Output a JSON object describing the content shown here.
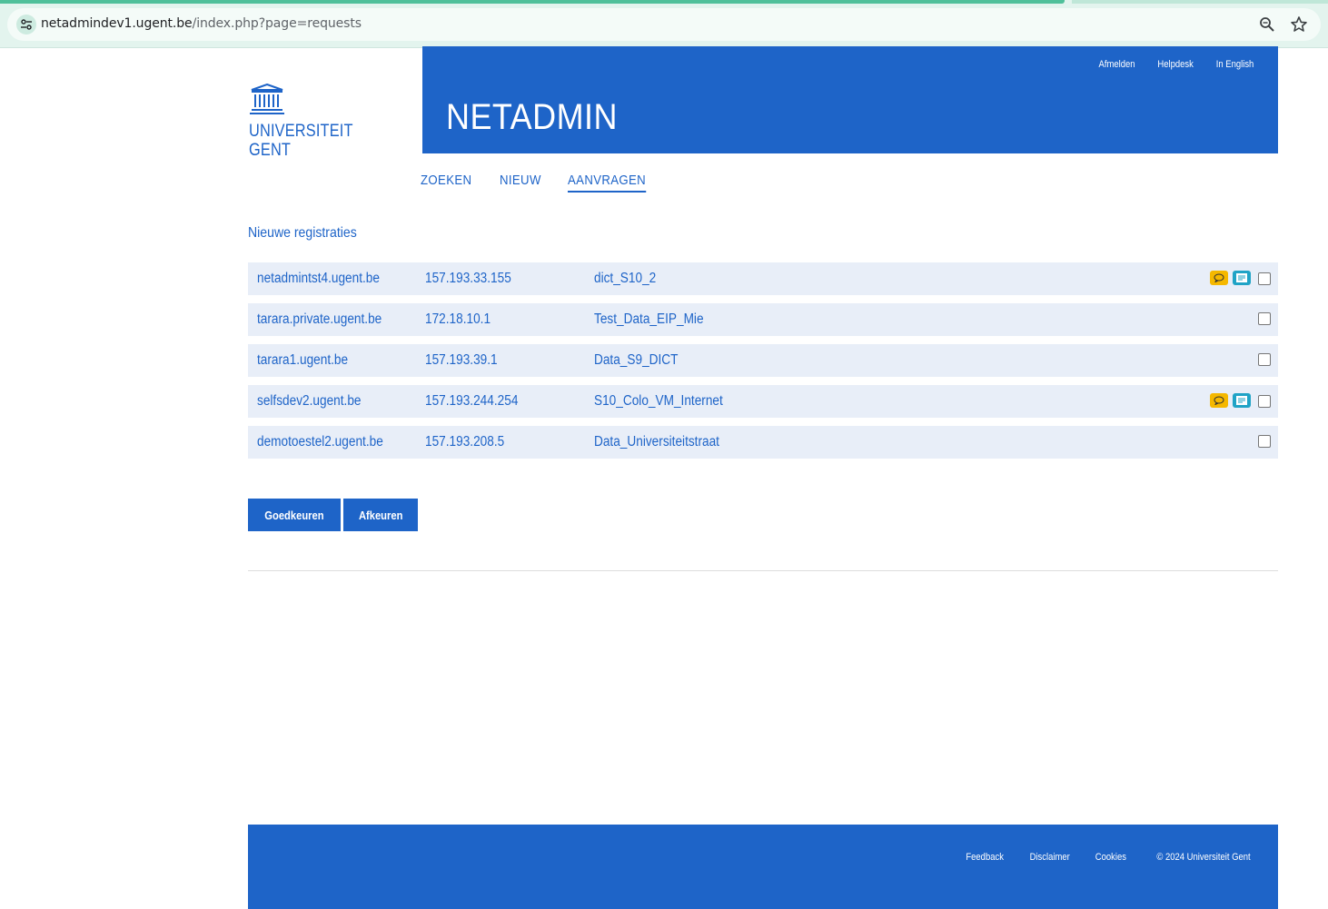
{
  "browser": {
    "url_host": "netadmindev1.ugent.be",
    "url_path": "/index.php?page=requests"
  },
  "logo": {
    "line1": "UNIVERSITEIT",
    "line2": "GENT"
  },
  "header": {
    "app_title": "NETADMIN",
    "links": {
      "logout": "Afmelden",
      "helpdesk": "Helpdesk",
      "english": "In English"
    }
  },
  "nav": {
    "search": "ZOEKEN",
    "new": "NIEUW",
    "requests": "AANVRAGEN",
    "active": "AANVRAGEN"
  },
  "section_title": "Nieuwe registraties",
  "requests": [
    {
      "host": "netadmintst4.ugent.be",
      "ip": "157.193.33.155",
      "network": "dict_S10_2",
      "has_comment": true,
      "has_info": true,
      "checked": false
    },
    {
      "host": "tarara.private.ugent.be",
      "ip": "172.18.10.1",
      "network": "Test_Data_EIP_Mie",
      "has_comment": false,
      "has_info": false,
      "checked": false
    },
    {
      "host": "tarara1.ugent.be",
      "ip": "157.193.39.1",
      "network": "Data_S9_DICT",
      "has_comment": false,
      "has_info": false,
      "checked": false
    },
    {
      "host": "selfsdev2.ugent.be",
      "ip": "157.193.244.254",
      "network": "S10_Colo_VM_Internet",
      "has_comment": true,
      "has_info": true,
      "checked": false
    },
    {
      "host": "demotoestel2.ugent.be",
      "ip": "157.193.208.5",
      "network": "Data_Universiteitstraat",
      "has_comment": false,
      "has_info": false,
      "checked": false
    }
  ],
  "actions": {
    "approve": "Goedkeuren",
    "reject": "Afkeuren"
  },
  "footer": {
    "feedback": "Feedback",
    "disclaimer": "Disclaimer",
    "cookies": "Cookies",
    "copyright": "© 2024 Universiteit Gent"
  },
  "colors": {
    "brand_blue": "#1e64c8",
    "row_bg": "#e8eef8",
    "comment_badge": "#f5b800",
    "info_badge": "#1fa3c6"
  },
  "icons": {
    "site_info": "tune-icon",
    "zoom": "zoom-icon",
    "bookmark": "star-icon",
    "comment": "speech-bubble-icon",
    "info": "card-icon"
  }
}
